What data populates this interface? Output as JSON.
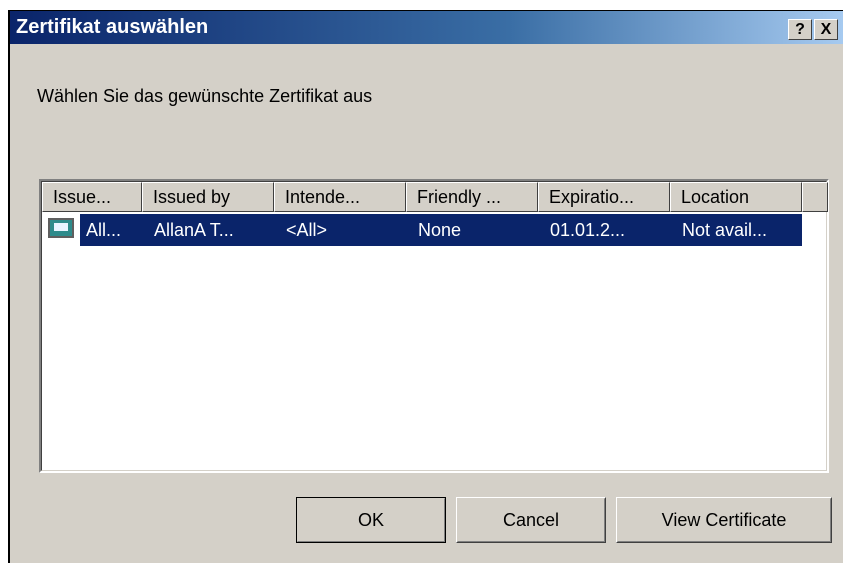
{
  "window": {
    "title": "Zertifikat auswählen",
    "help_label": "?",
    "close_label": "X"
  },
  "prompt": "Wählen Sie das gewünschte Zertifikat aus",
  "table": {
    "columns": [
      "Issue...",
      "Issued by",
      "Intende...",
      "Friendly ...",
      "Expiratio...",
      "Location"
    ],
    "rows": [
      {
        "icon": "certificate-icon",
        "cells": [
          "All...",
          "AllanA T...",
          "<All>",
          "None",
          "01.01.2...",
          "Not avail..."
        ],
        "selected": true
      }
    ]
  },
  "buttons": {
    "ok": "OK",
    "cancel": "Cancel",
    "view": "View Certificate"
  },
  "colors": {
    "titlebar_start": "#0a246a",
    "titlebar_end": "#a6caf0",
    "selection": "#0a246a",
    "dialog_bg": "#d4d0c8"
  }
}
